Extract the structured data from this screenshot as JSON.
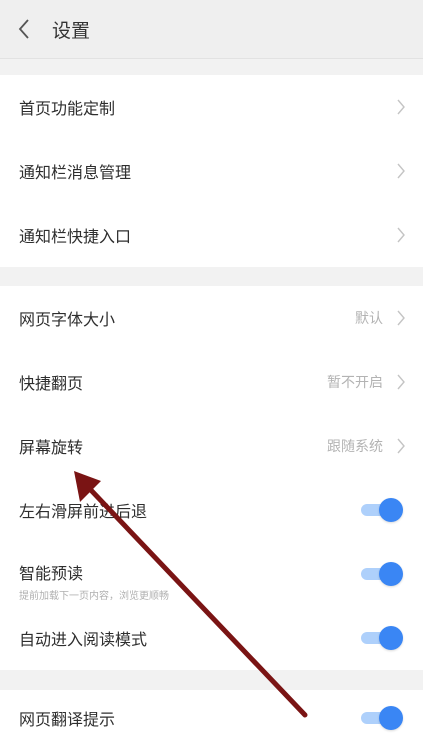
{
  "header": {
    "title": "设置"
  },
  "groups": [
    {
      "items": [
        {
          "label": "首页功能定制"
        },
        {
          "label": "通知栏消息管理"
        },
        {
          "label": "通知栏快捷入口"
        }
      ]
    },
    {
      "items": [
        {
          "label": "网页字体大小",
          "value": "默认"
        },
        {
          "label": "快捷翻页",
          "value": "暂不开启"
        },
        {
          "label": "屏幕旋转",
          "value": "跟随系统"
        },
        {
          "label": "左右滑屏前进后退",
          "on": true
        },
        {
          "label": "智能预读",
          "sub": "提前加载下一页内容，浏览更顺畅",
          "on": true
        },
        {
          "label": "自动进入阅读模式",
          "on": true
        }
      ]
    },
    {
      "items": [
        {
          "label": "网页翻译提示",
          "on": true
        }
      ]
    }
  ],
  "colors": {
    "accent": "#3a86f4",
    "track": "#aed0fb",
    "annotation_arrow": "#7a1414"
  }
}
